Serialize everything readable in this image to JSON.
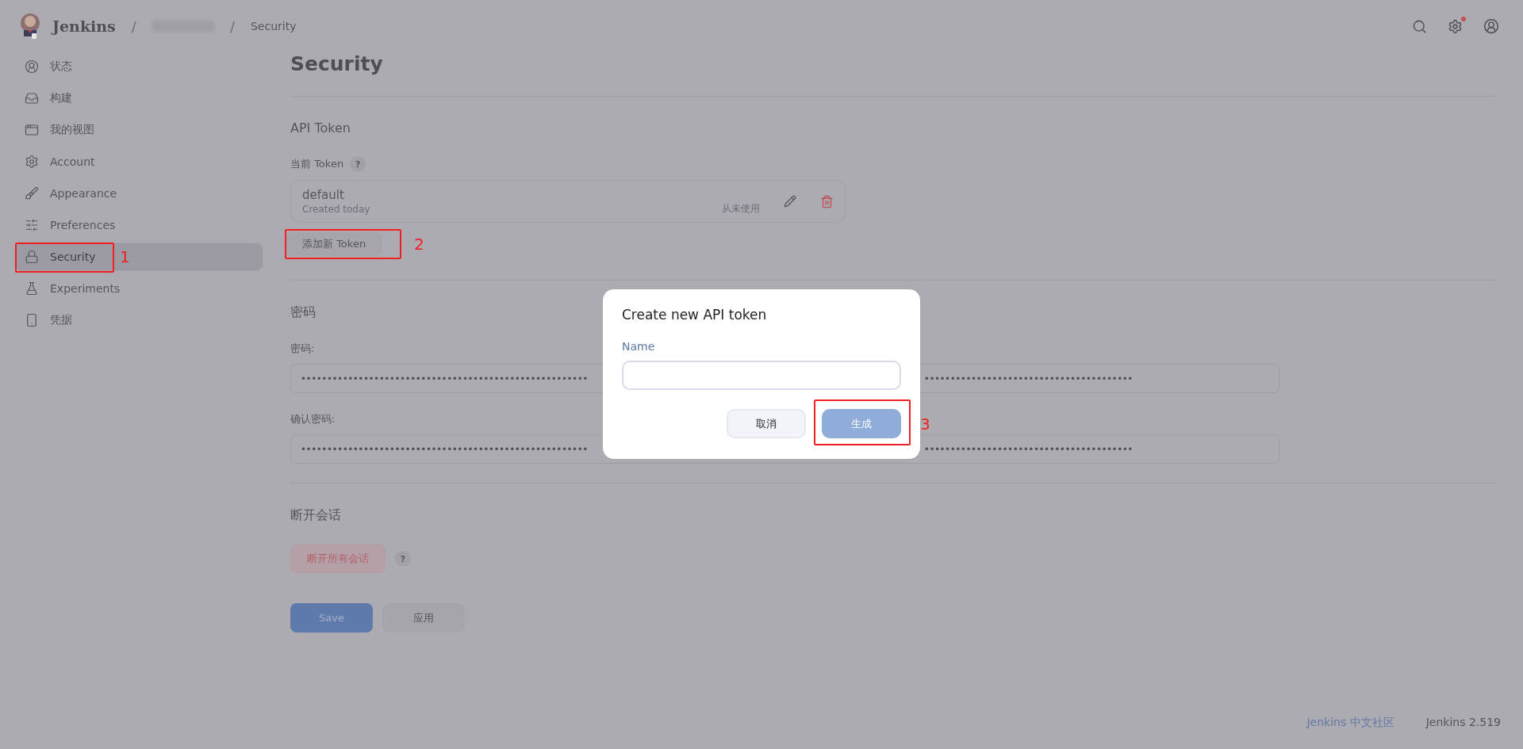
{
  "header": {
    "logo_text": "Jenkins",
    "breadcrumbs": [
      {
        "kind": "redacted",
        "separator": "/"
      },
      {
        "kind": "text",
        "separator": "/",
        "label": "Security"
      }
    ],
    "settings_badge": true
  },
  "sidebar": {
    "items": [
      {
        "label": "状态",
        "kind": "user",
        "selected": false
      },
      {
        "label": "构建",
        "kind": "inbox",
        "selected": false
      },
      {
        "label": "我的视图",
        "kind": "window",
        "selected": false
      },
      {
        "label": "Account",
        "kind": "gear",
        "selected": false
      },
      {
        "label": "Appearance",
        "kind": "brush",
        "selected": false
      },
      {
        "label": "Preferences",
        "kind": "sliders",
        "selected": false
      },
      {
        "label": "Security",
        "kind": "lock",
        "selected": true,
        "annotation": "1"
      },
      {
        "label": "Experiments",
        "kind": "flask",
        "selected": false
      },
      {
        "label": "凭据",
        "kind": "phone",
        "selected": false
      }
    ]
  },
  "page_title": "Security",
  "api_token": {
    "heading": "API Token",
    "current_label": "当前 Token",
    "help": "?",
    "tokens": [
      {
        "name": "default",
        "created": "Created today",
        "usage": "从未使用"
      }
    ],
    "add_button": {
      "label": "添加新 Token",
      "annotation": "2"
    }
  },
  "password": {
    "heading": "密码",
    "fields": [
      {
        "label": "密码:",
        "value_segments": [
          "•••••••••••••••••••••••••••••••••••••••••••••••••••••••",
          "••••••••••••••••••••••••••••••••••••••••"
        ]
      },
      {
        "label": "确认密码:",
        "value_segments": [
          "•••••••••••••••••••••••••••••••••••••••••••••••••••••••",
          "••••••••••••••••••••••••••••••••••••••••"
        ]
      }
    ]
  },
  "sessions": {
    "heading": "断开会话",
    "button": "断开所有会话",
    "help": "?"
  },
  "actions": [
    {
      "label": "Save",
      "kind": "primary"
    },
    {
      "label": "应用",
      "kind": "secondary"
    }
  ],
  "footer": {
    "link": "Jenkins 中文社区",
    "version": "Jenkins 2.519"
  },
  "dialog": {
    "title": "Create new API token",
    "field_label": "Name",
    "buttons": [
      {
        "label": "取消",
        "kind": "secondary",
        "disabled": false
      },
      {
        "label": "生成",
        "kind": "primary",
        "disabled": true,
        "annotation": "3"
      }
    ]
  }
}
